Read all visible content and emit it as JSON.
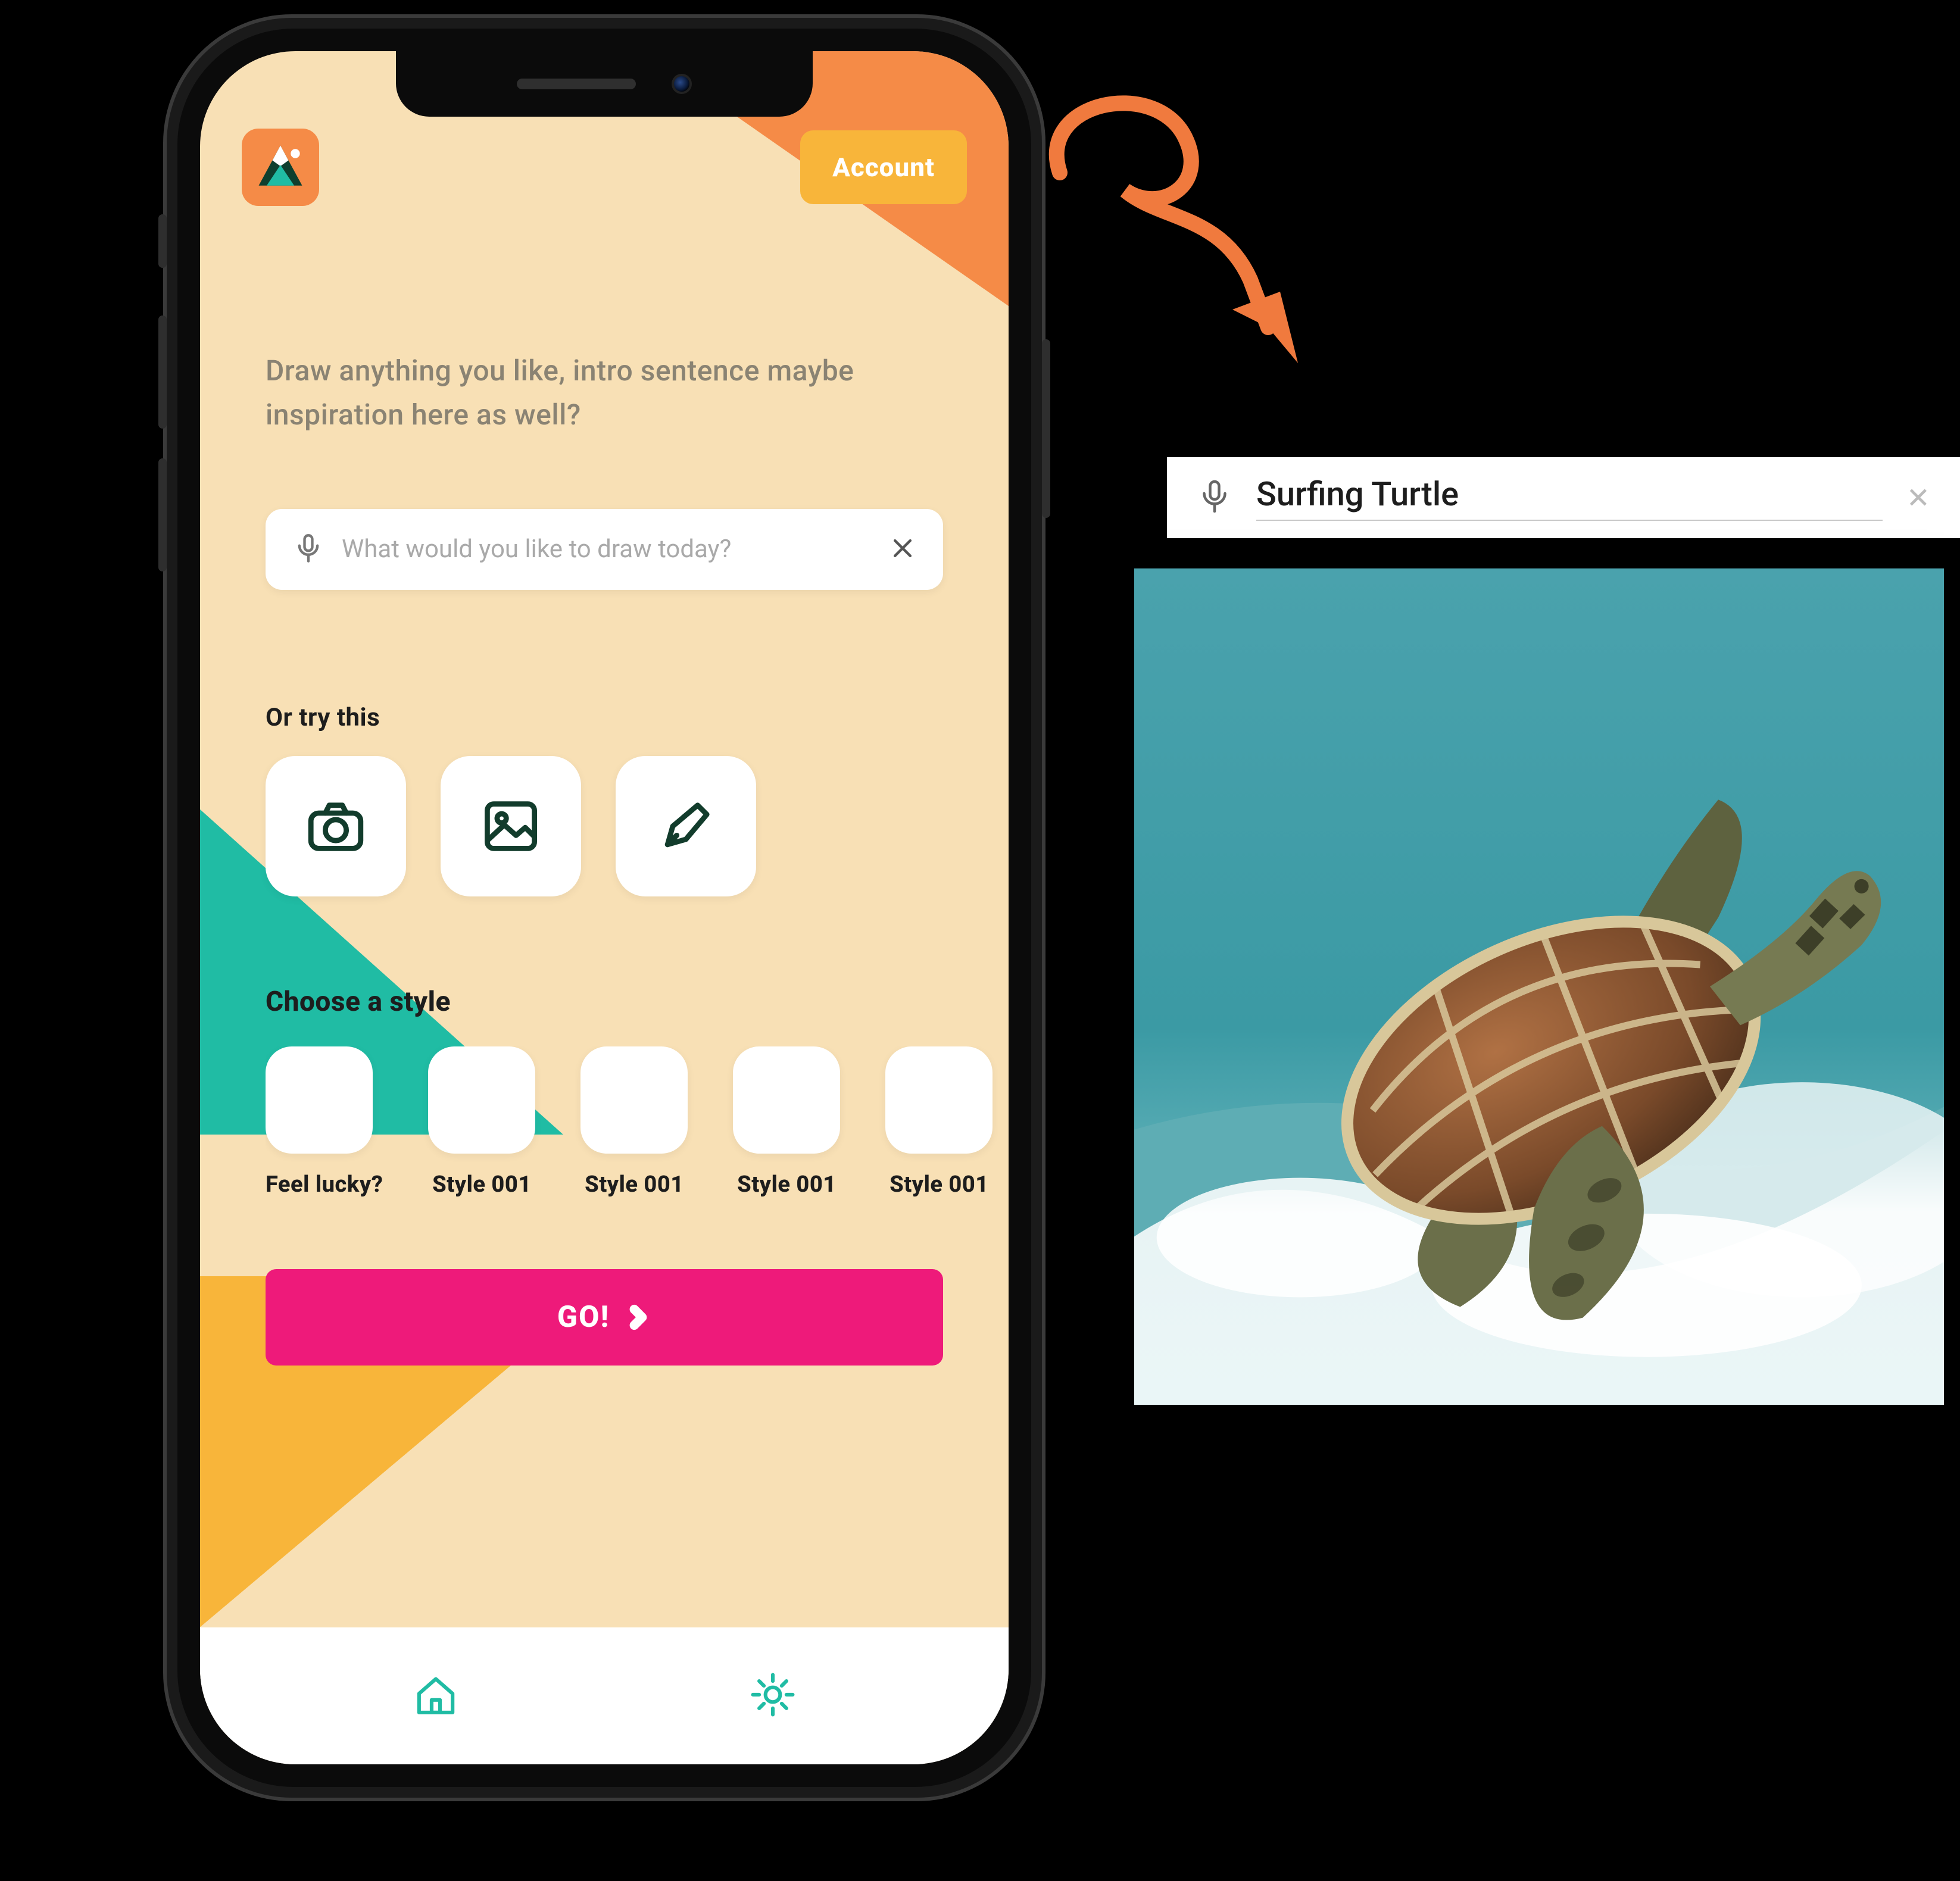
{
  "header": {
    "account_label": "Account"
  },
  "intro_text": "Draw anything you like, intro sentence maybe inspiration here as well?",
  "prompt": {
    "placeholder": "What would you like to draw today?",
    "value": ""
  },
  "or_try_label": "Or try this",
  "alt_tools": [
    {
      "name": "camera"
    },
    {
      "name": "image"
    },
    {
      "name": "pen"
    }
  ],
  "choose_style_label": "Choose a style",
  "styles": [
    {
      "label": "Feel lucky?"
    },
    {
      "label": "Style 001"
    },
    {
      "label": "Style 001"
    },
    {
      "label": "Style 001"
    },
    {
      "label": "Style 001"
    }
  ],
  "go_label": "GO!",
  "external_search": {
    "value": "Surfing Turtle"
  },
  "colors": {
    "bg": "#F8E0B5",
    "orange": "#F58B47",
    "yellow": "#F8B53A",
    "teal": "#20BCA4",
    "pink": "#EE1A7A"
  }
}
